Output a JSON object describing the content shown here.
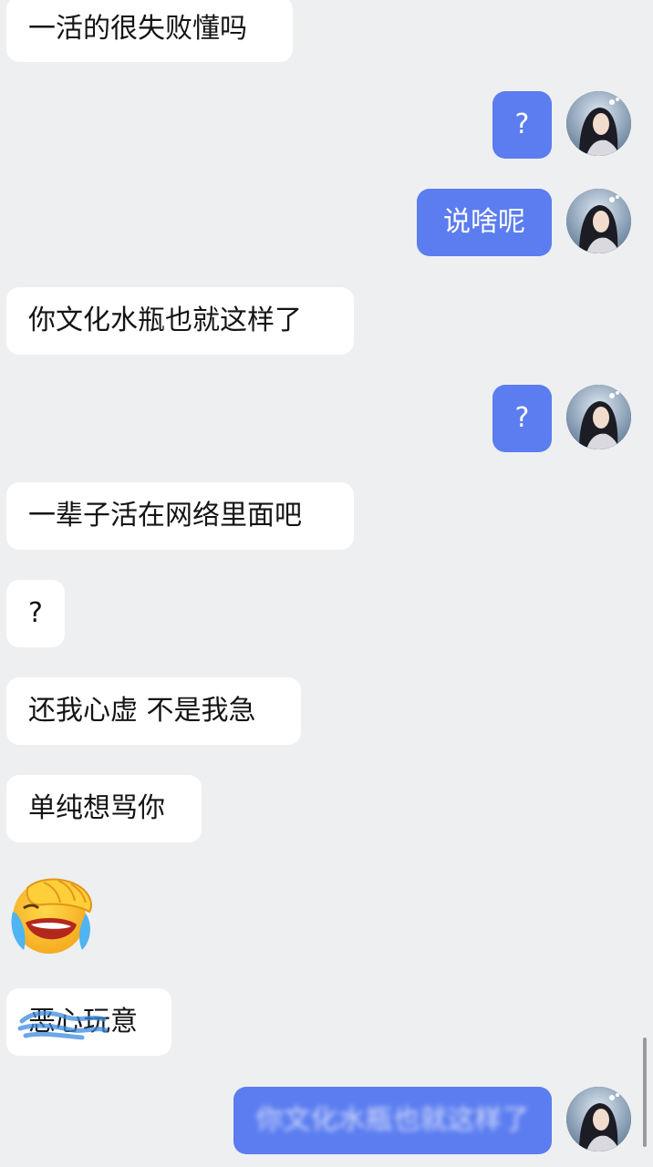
{
  "colors": {
    "background": "#eeeff1",
    "incoming_bubble": "#ffffff",
    "outgoing_bubble": "#5b7df0",
    "scribble": "#3b8be0"
  },
  "messages": [
    {
      "side": "left",
      "text": "一活的很失败懂吗"
    },
    {
      "side": "right",
      "text": "?"
    },
    {
      "side": "right",
      "text": "说啥呢"
    },
    {
      "side": "left",
      "text": "你文化水瓶也就这样了"
    },
    {
      "side": "right",
      "text": "?"
    },
    {
      "side": "left",
      "text": "一辈子活在网络里面吧"
    },
    {
      "side": "left",
      "text": "?"
    },
    {
      "side": "left",
      "text": "还我心虚 不是我急"
    },
    {
      "side": "left",
      "text": "单纯想骂你"
    },
    {
      "side": "left",
      "icon": "facepalm-crying-emoji"
    },
    {
      "side": "left",
      "text": "恶心玩意"
    },
    {
      "side": "right",
      "text": "你文化水瓶也就这样了"
    }
  ],
  "avatar_icon": "girl-portrait-avatar"
}
